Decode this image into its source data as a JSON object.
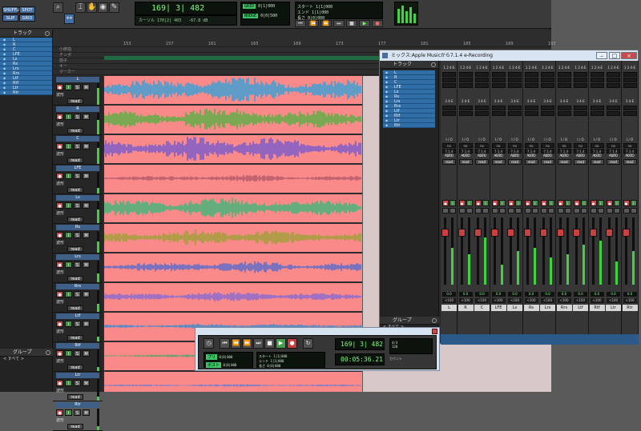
{
  "edit": {
    "mode_buttons": [
      "SHUFFLE",
      "SPOT",
      "SLIP",
      "GRID"
    ],
    "tools": [
      "zoom-tool",
      "trim-tool",
      "selector-tool",
      "grabber-tool",
      "scrubber-tool",
      "pencil-tool"
    ],
    "counter_main": "169| 3| 482",
    "counter_sub_left": "カーソル 170|2| 403",
    "counter_sub_right": "-67.8 dB",
    "grid_tag": "GRID",
    "nudge_tag": "NUDGE",
    "grid_value": "0|1|000",
    "nudge_value": "0|0|500",
    "sel_start_label": "スタート",
    "sel_end_label": "エンド",
    "sel_len_label": "長さ",
    "sel_start": "1|1|000",
    "sel_end": "1|1|000",
    "sel_len": "0|0|000",
    "tracks_header": "トラック",
    "group_header": "グループ",
    "group_row": "< すべて >",
    "track_names": [
      "L",
      "R",
      "C",
      "LFE",
      "Ls",
      "Rs",
      "Lrs",
      "Rrs",
      "Ltf",
      "Rtf",
      "Ltr",
      "Rtr"
    ],
    "ruler_rows": [
      "小節拍",
      "テンポ",
      "拍子",
      "キー",
      "マーカー"
    ],
    "bars": [
      "153",
      "157",
      "161",
      "165",
      "169",
      "173",
      "177",
      "181",
      "185",
      "189",
      "193"
    ],
    "auto_label": "波形",
    "read_label": "read",
    "rec_btn": "●",
    "inp_btn": "I",
    "solo_btn": "S",
    "mute_btn": "M"
  },
  "mix": {
    "title": "ミックス:Apple Musicから7.1.4 e-Recording",
    "tracks_header": "トラック",
    "group_header": "グループ",
    "group_row": "< すべて >",
    "io_top": "1 2 4-E",
    "io_mid": "3 4-E",
    "io_label": "I / O",
    "io_in": "no input",
    "io_out": "7.1.4 Out",
    "auto": "AUTO",
    "read": "read",
    "strip_names": [
      "L",
      "R",
      "C",
      "LFE",
      "Ls",
      "Rs",
      "Lrs",
      "Rrs",
      "Ltf",
      "Rtf",
      "Ltr",
      "Rtr"
    ],
    "vol_value": "0.0",
    "pan_value": "<100",
    "meter_levels": [
      0.55,
      0.45,
      0.7,
      0.3,
      0.5,
      0.55,
      0.4,
      0.45,
      0.6,
      0.65,
      0.35,
      0.5
    ]
  },
  "transport": {
    "main_counter": "169| 3| 482",
    "sub_counter": "00:05:36.21",
    "pre_label": "プリ",
    "post_label": "ポスト",
    "pre_value": "0|0|000",
    "post_value": "0|0|000",
    "start_value": "1|1|000",
    "end_value": "1|1|000",
    "len_value": "0|0|000",
    "tempo_label": "4/4",
    "tempo_value": "120",
    "click_label": "カウント"
  },
  "colors": {
    "playlist_bg": "#fa8a8a",
    "wave_L": "#3aa0d8",
    "wave_R": "#5bb044",
    "wave_C": "#7a5ccc",
    "wave_LFE": "#b45a6a",
    "wave_Ls": "#3fb87a",
    "wave_Rs": "#a0a03a",
    "wave_Lrs": "#5a6ccc",
    "wave_Rrs": "#8a6ad0",
    "wave_Ltf": "#3a8ad0",
    "wave_Rtf": "#4fa46a",
    "wave_Ltr": "#6a7cd0",
    "selection": "#2f6ea6",
    "meter": "#3fd23f"
  }
}
